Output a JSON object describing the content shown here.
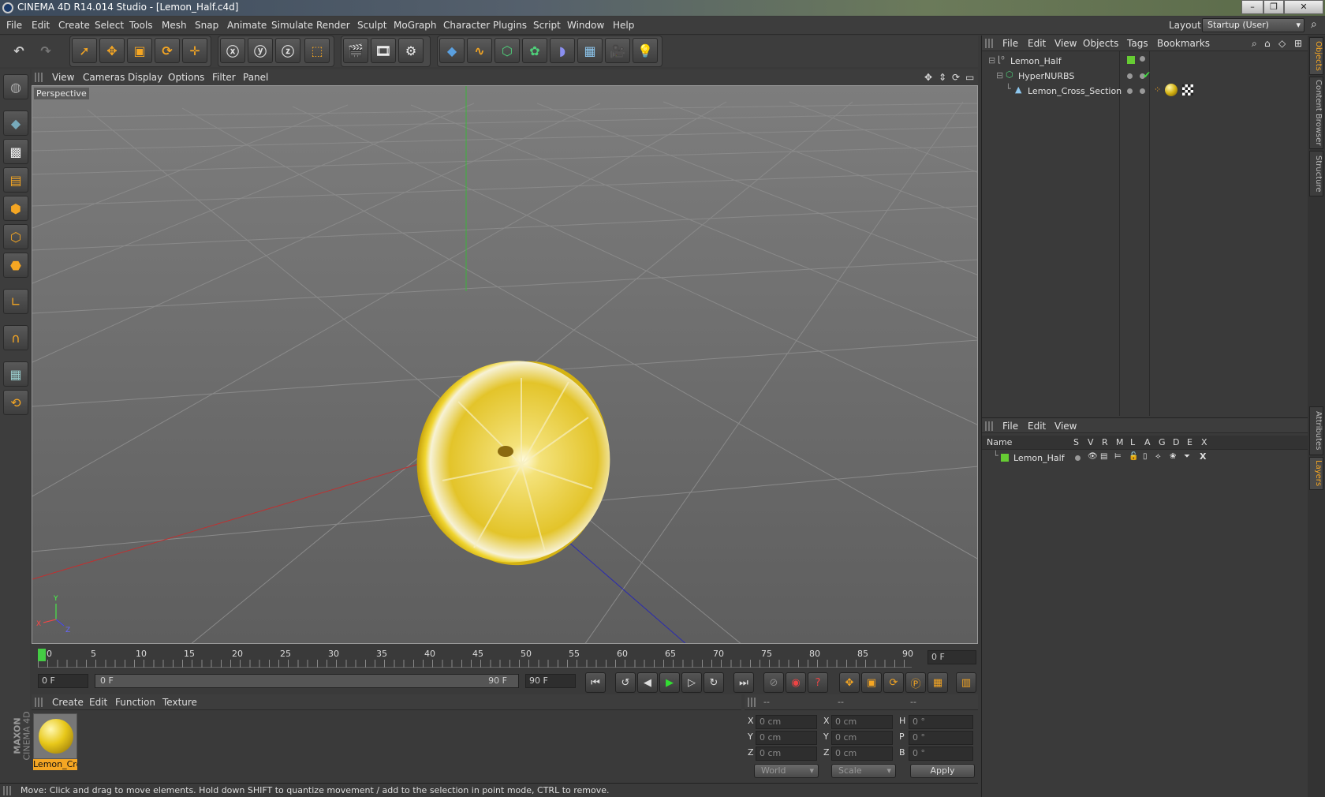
{
  "window": {
    "title": "CINEMA 4D R14.014 Studio - [Lemon_Half.c4d]"
  },
  "menu": [
    "File",
    "Edit",
    "Create",
    "Select",
    "Tools",
    "Mesh",
    "Snap",
    "Animate",
    "Simulate",
    "Render",
    "Sculpt",
    "MoGraph",
    "Character",
    "Plugins",
    "Script",
    "Window",
    "Help"
  ],
  "layout": {
    "label": "Layout:",
    "value": "Startup (User)"
  },
  "viewport": {
    "menu": [
      "View",
      "Cameras",
      "Display",
      "Options",
      "Filter",
      "Panel"
    ],
    "camera_label": "Perspective"
  },
  "timeline": {
    "ticks": [
      "0",
      "5",
      "10",
      "15",
      "20",
      "25",
      "30",
      "35",
      "40",
      "45",
      "50",
      "55",
      "60",
      "65",
      "70",
      "75",
      "80",
      "85",
      "90"
    ],
    "current_frame": "0 F",
    "start_field": "0 F",
    "range_start": "0 F",
    "range_end": "90 F",
    "end_field": "90 F"
  },
  "materials": {
    "menu": [
      "Create",
      "Edit",
      "Function",
      "Texture"
    ],
    "items": [
      {
        "name": "Lemon_Cro"
      }
    ]
  },
  "coords": {
    "headers": [
      "--",
      "--",
      "--"
    ],
    "rows": [
      {
        "a": "X",
        "av": "0 cm",
        "b": "X",
        "bv": "0 cm",
        "c": "H",
        "cv": "0 °"
      },
      {
        "a": "Y",
        "av": "0 cm",
        "b": "Y",
        "bv": "0 cm",
        "c": "P",
        "cv": "0 °"
      },
      {
        "a": "Z",
        "av": "0 cm",
        "b": "Z",
        "bv": "0 cm",
        "c": "B",
        "cv": "0 °"
      }
    ],
    "mode": "World",
    "scale": "Scale",
    "apply": "Apply"
  },
  "status": "Move: Click and drag to move elements. Hold down SHIFT to quantize movement / add to the selection in point mode, CTRL to remove.",
  "objects_panel": {
    "menu": [
      "File",
      "Edit",
      "View",
      "Objects",
      "Tags",
      "Bookmarks"
    ],
    "items": [
      {
        "name": "Lemon_Half"
      },
      {
        "name": "HyperNURBS"
      },
      {
        "name": "Lemon_Cross_Section"
      }
    ]
  },
  "layers_panel": {
    "menu": [
      "File",
      "Edit",
      "View"
    ],
    "columns": [
      "Name",
      "S",
      "V",
      "R",
      "M",
      "L",
      "A",
      "G",
      "D",
      "E",
      "X"
    ],
    "items": [
      {
        "name": "Lemon_Half"
      }
    ]
  },
  "side_tabs": [
    "Objects",
    "Content Browser",
    "Structure",
    "Attributes",
    "Layers"
  ],
  "brand": {
    "maxon": "MAXON",
    "product": "CINEMA 4D"
  },
  "colors": {
    "accent": "#f5a623",
    "layer_green": "#66cc33",
    "lemon": "#e8c81a"
  }
}
